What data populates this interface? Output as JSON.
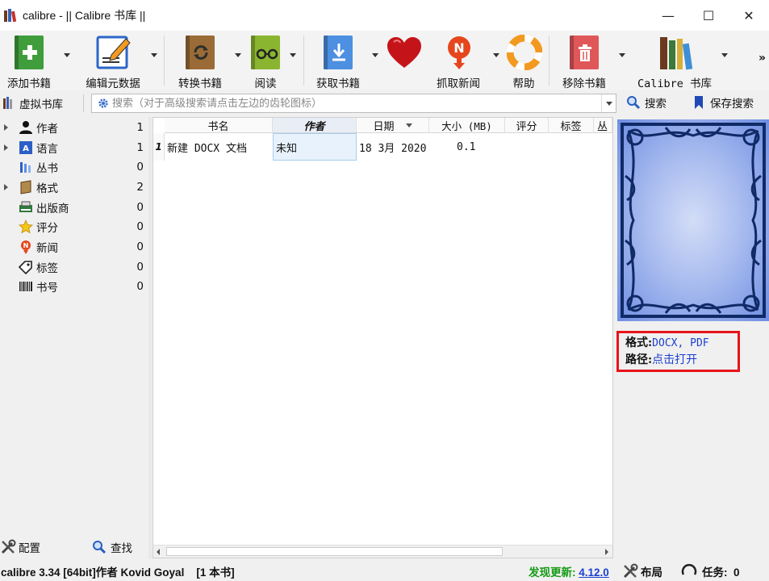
{
  "window": {
    "title": "calibre - || Calibre 书库 ||",
    "minimize": "—",
    "maximize": "☐",
    "close": "✕"
  },
  "toolbar": {
    "add_books": "添加书籍",
    "edit_metadata": "编辑元数据",
    "convert_books": "转换书籍",
    "view": "阅读",
    "get_books": "获取书籍",
    "fetch_news": "抓取新闻",
    "help": "帮助",
    "remove_books": "移除书籍",
    "library": "Calibre 书库",
    "more": "»"
  },
  "searchbar": {
    "virtual_library": "虚拟书库",
    "placeholder": "搜索（对于高级搜索请点击左边的齿轮图标）",
    "search_button": "搜索",
    "saved_search": "保存搜索"
  },
  "tag_browser": {
    "items": [
      {
        "label": "作者",
        "count": "1",
        "expandable": true
      },
      {
        "label": "语言",
        "count": "1",
        "expandable": true
      },
      {
        "label": "丛书",
        "count": "0",
        "expandable": false
      },
      {
        "label": "格式",
        "count": "2",
        "expandable": true
      },
      {
        "label": "出版商",
        "count": "0",
        "expandable": false
      },
      {
        "label": "评分",
        "count": "0",
        "expandable": false
      },
      {
        "label": "新闻",
        "count": "0",
        "expandable": false
      },
      {
        "label": "标签",
        "count": "0",
        "expandable": false
      },
      {
        "label": "书号",
        "count": "0",
        "expandable": false
      }
    ],
    "configure": "配置",
    "find": "查找"
  },
  "book_list": {
    "columns": [
      "书名",
      "作者",
      "日期",
      "大小 (MB)",
      "评分",
      "标签",
      "丛"
    ],
    "rows": [
      {
        "num": "1",
        "title": "新建 DOCX 文档",
        "author": "未知",
        "date": "18 3月 2020",
        "size": "0.1"
      }
    ]
  },
  "book_details": {
    "formats_label": "格式:",
    "formats_value": "DOCX, PDF",
    "path_label": "路径:",
    "path_value": "点击打开"
  },
  "status": {
    "version_info": "calibre 3.34 [64bit]作者 Kovid Goyal    [1 本书]",
    "update_label": "发现更新:",
    "update_version": "4.12.0",
    "layout": "布局",
    "jobs": "任务:  0"
  },
  "colors": {
    "highlight_box": "#e8141b",
    "link": "#1a3fd1",
    "update_green": "#169b16"
  }
}
